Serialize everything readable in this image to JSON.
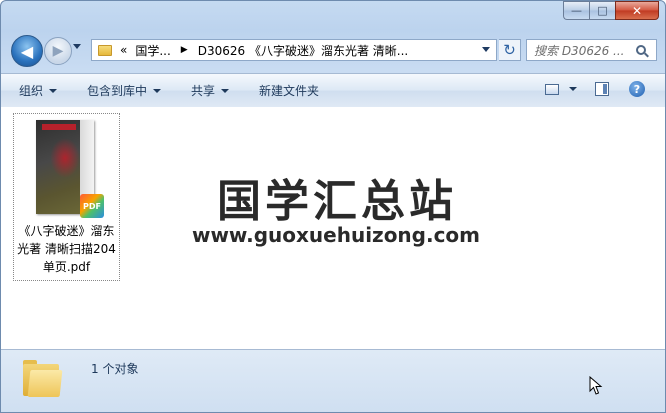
{
  "window": {
    "minimize_glyph": "—",
    "maximize_glyph": "□",
    "close_glyph": "✕"
  },
  "nav": {
    "back_glyph": "◀",
    "forward_glyph": "▶",
    "address": {
      "lead_chevron": "«",
      "crumbs": [
        "国学...",
        "D30626 《八字破迷》溜东光著 清晰..."
      ],
      "separator": "▶"
    },
    "refresh_glyph": "↻",
    "search_placeholder": "搜索 D30626 ..."
  },
  "toolbar": {
    "items": [
      "组织",
      "包含到库中",
      "共享",
      "新建文件夹"
    ],
    "help_glyph": "?"
  },
  "content": {
    "file": {
      "name": "《八字破迷》溜东光著 清晰扫描204单页.pdf",
      "badge": "PDF"
    },
    "watermark": {
      "title": "国学汇总站",
      "url": "www.guoxuehuizong.com"
    }
  },
  "status": {
    "text": "1 个对象"
  },
  "icons": {
    "back": "back-arrow-icon",
    "forward": "forward-arrow-icon",
    "folder": "folder-icon",
    "refresh": "refresh-icon",
    "search": "search-icon",
    "view": "view-options-icon",
    "pane": "preview-pane-icon",
    "help": "help-icon"
  }
}
